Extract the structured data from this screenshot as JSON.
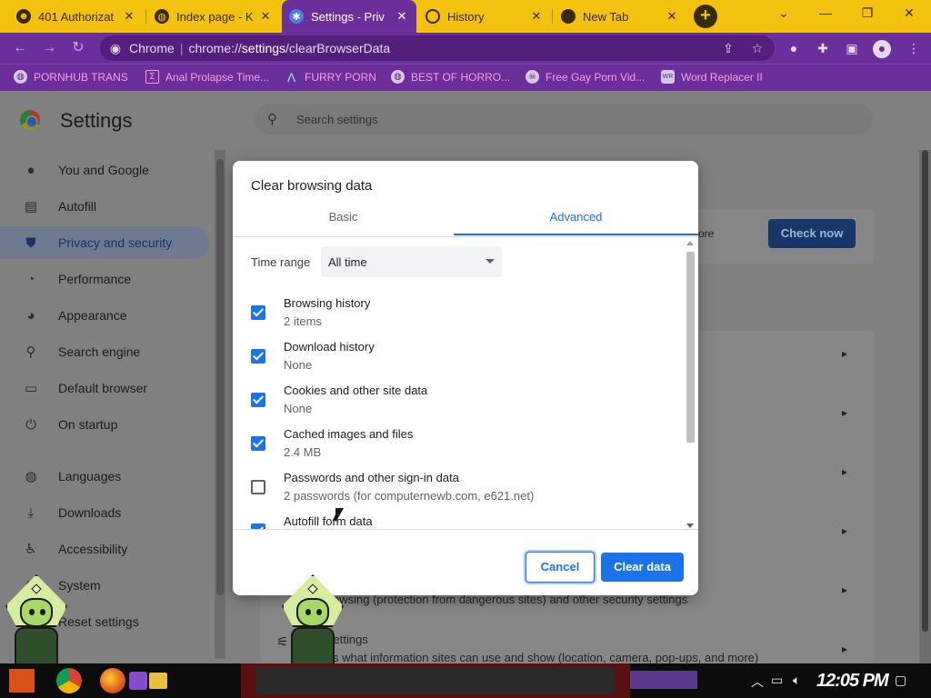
{
  "browser": {
    "tabs": [
      {
        "label": "401 Authorizat",
        "icon": "hacker-favicon"
      },
      {
        "label": "Index page - K",
        "icon": "globe-favicon"
      },
      {
        "label": "Settings - Priv",
        "icon": "gear-favicon",
        "active": true
      },
      {
        "label": "History",
        "icon": "history-favicon"
      },
      {
        "label": "New Tab",
        "icon": "chrome-favicon"
      }
    ],
    "new_tab_label": "+",
    "window_controls": {
      "minimize": "—",
      "maximize": "❐",
      "close": "✕"
    },
    "omnibox": {
      "site_label": "Chrome",
      "url_prefix": "chrome://",
      "url_host": "settings",
      "url_path": "/clearBrowserData"
    },
    "bookmarks": [
      {
        "label": "PORNHUB TRANS",
        "icon": "globe-icon"
      },
      {
        "label": "Anal Prolapse Time...",
        "icon": "bookmark-icon"
      },
      {
        "label": "FURRY PORN",
        "icon": "a-logo-icon"
      },
      {
        "label": "BEST OF HORRO...",
        "icon": "globe-icon"
      },
      {
        "label": "Free Gay Porn Vid...",
        "icon": "skull-icon"
      },
      {
        "label": "Word Replacer II",
        "icon": "wr-icon"
      }
    ],
    "colors": {
      "tabstrip": "#f3c20e",
      "frame": "#6a2f9a",
      "bookmark_text": "#f8a0e6"
    }
  },
  "settings": {
    "title": "Settings",
    "search_placeholder": "Search settings",
    "nav": [
      {
        "label": "You and Google",
        "icon": "person-icon"
      },
      {
        "label": "Autofill",
        "icon": "clipboard-icon"
      },
      {
        "label": "Privacy and security",
        "icon": "shield-icon",
        "active": true
      },
      {
        "label": "Performance",
        "icon": "speedometer-icon"
      },
      {
        "label": "Appearance",
        "icon": "palette-icon"
      },
      {
        "label": "Search engine",
        "icon": "search-icon"
      },
      {
        "label": "Default browser",
        "icon": "browser-icon"
      },
      {
        "label": "On startup",
        "icon": "power-icon"
      },
      {
        "label": "Languages",
        "icon": "globe-icon"
      },
      {
        "label": "Downloads",
        "icon": "download-icon"
      },
      {
        "label": "Accessibility",
        "icon": "accessibility-icon"
      },
      {
        "label": "System",
        "icon": "wrench-icon"
      },
      {
        "label": "Reset settings",
        "icon": "reset-icon"
      }
    ],
    "background": {
      "more_text": "ore",
      "check_now": "Check now",
      "safe_browsing_text": "owsing (protection from dangerous sites) and other security settings",
      "site_settings_title": "settings",
      "site_settings_desc": "s what information sites can use and show (location, camera, pop-ups, and more)"
    }
  },
  "dialog": {
    "title": "Clear browsing data",
    "tabs": {
      "basic": "Basic",
      "advanced": "Advanced"
    },
    "time_range_label": "Time range",
    "time_range_value": "All time",
    "options": [
      {
        "title": "Browsing history",
        "detail": "2 items",
        "checked": true
      },
      {
        "title": "Download history",
        "detail": "None",
        "checked": true
      },
      {
        "title": "Cookies and other site data",
        "detail": "None",
        "checked": true
      },
      {
        "title": "Cached images and files",
        "detail": "2.4 MB",
        "checked": true
      },
      {
        "title": "Passwords and other sign-in data",
        "detail": "2 passwords (for computernewb.com, e621.net)",
        "checked": false
      },
      {
        "title": "Autofill form data",
        "detail": "",
        "checked": true
      }
    ],
    "cancel_label": "Cancel",
    "clear_label": "Clear data",
    "accent": "#1a73e8"
  },
  "taskbar": {
    "clock": "12:05 PM",
    "apps": [
      "start-icon",
      "chrome-icon",
      "firefox-icon",
      "media-icon",
      "folder-icon"
    ]
  }
}
